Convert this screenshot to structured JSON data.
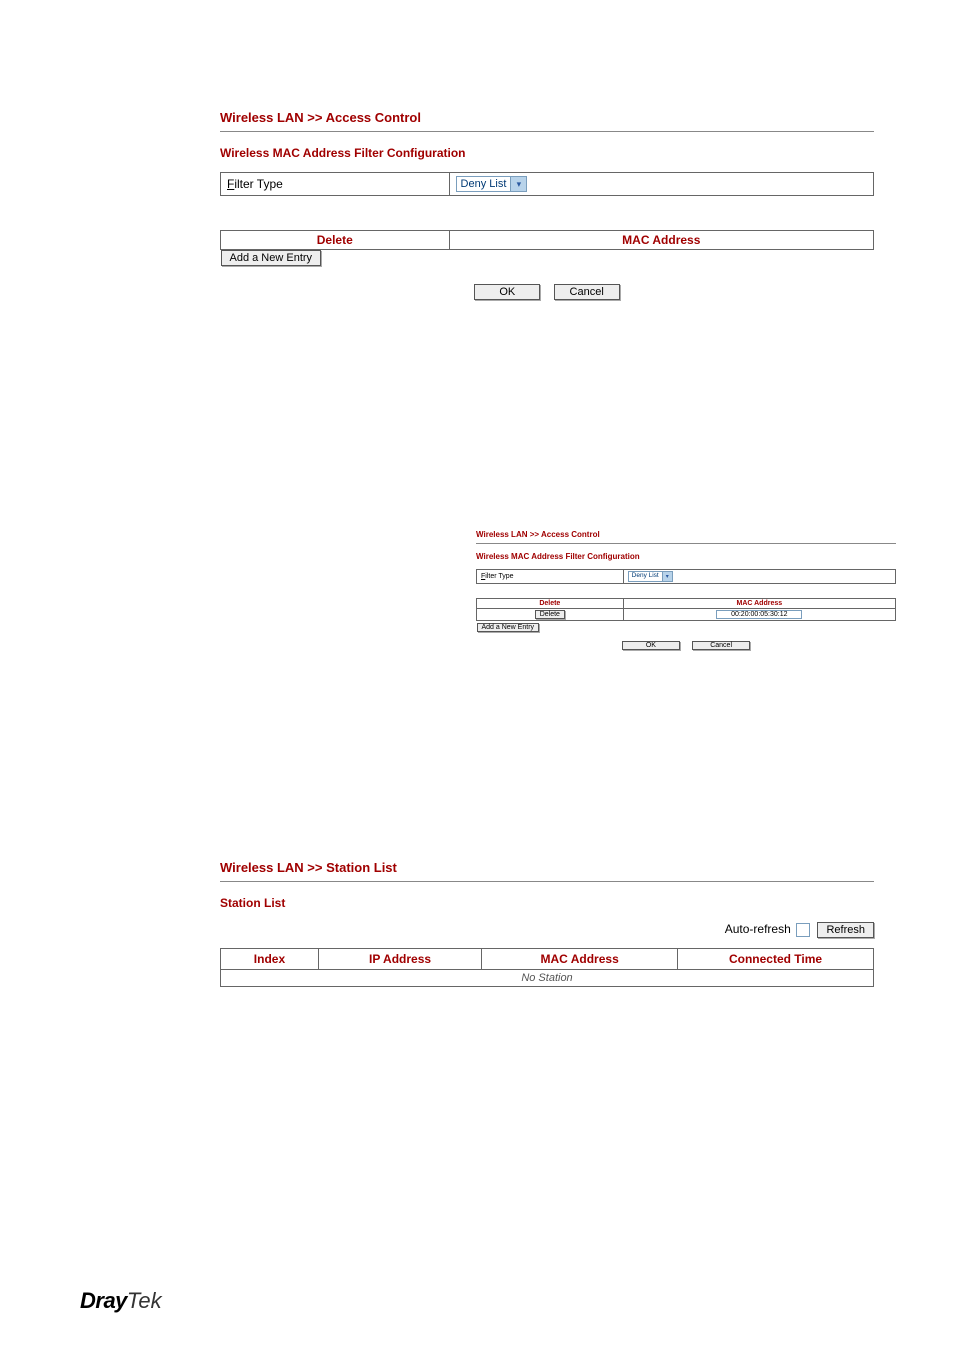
{
  "section1": {
    "title": "Wireless LAN >> Access Control",
    "subtitle": "Wireless MAC Address Filter Configuration",
    "filter_type_label": "Filter Type",
    "filter_type_prefix": "F",
    "filter_type_value": "Deny List",
    "mac_table": {
      "col_delete": "Delete",
      "col_mac": "MAC Address"
    },
    "add_button": "Add a New Entry",
    "ok": "OK",
    "cancel": "Cancel"
  },
  "section2": {
    "title": "Wireless LAN >> Access Control",
    "subtitle": "Wireless MAC Address Filter Configuration",
    "filter_type_label": "Filter Type",
    "filter_type_prefix": "F",
    "filter_type_value": "Deny List",
    "mac_table": {
      "col_delete": "Delete",
      "col_mac": "MAC Address",
      "row_delete_btn": "Delete",
      "row_mac_value": "00:20:00:05:30:12"
    },
    "add_button": "Add a New Entry",
    "ok": "OK",
    "cancel": "Cancel"
  },
  "section3": {
    "title": "Wireless LAN >> Station List",
    "subtitle": "Station List",
    "auto_refresh_label": "Auto-refresh",
    "refresh_button": "Refresh",
    "cols": {
      "index": "Index",
      "ip": "IP Address",
      "mac": "MAC Address",
      "time": "Connected Time"
    },
    "no_station": "No Station"
  },
  "logo": {
    "part1": "Dray",
    "part2": "Tek"
  }
}
